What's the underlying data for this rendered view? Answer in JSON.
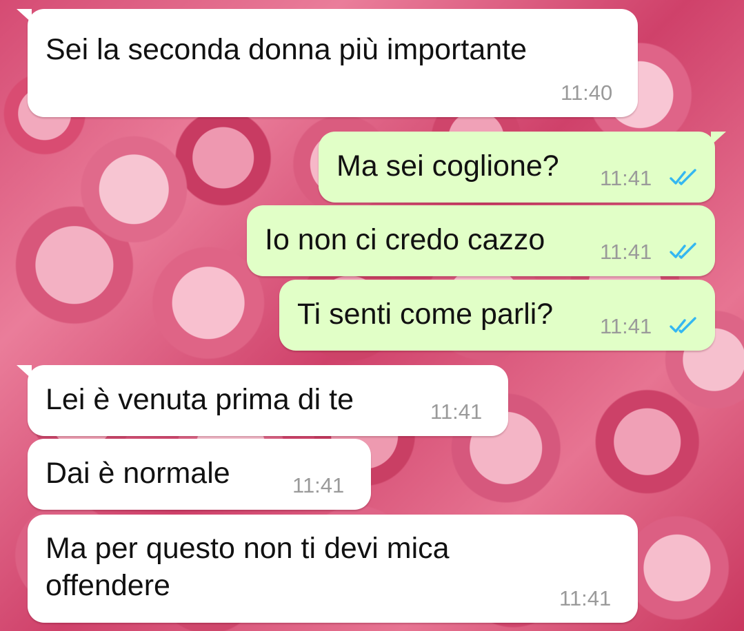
{
  "chat": {
    "messages": [
      {
        "direction": "incoming",
        "text": "Sei la seconda donna più importante",
        "time": "11:40"
      },
      {
        "direction": "outgoing",
        "text": "Ma sei coglione?",
        "time": "11:41",
        "status_icon": "double-check-icon"
      },
      {
        "direction": "outgoing",
        "text": "Io non ci credo cazzo",
        "time": "11:41",
        "status_icon": "double-check-icon"
      },
      {
        "direction": "outgoing",
        "text": "Ti senti come parli?",
        "time": "11:41",
        "status_icon": "double-check-icon"
      },
      {
        "direction": "incoming",
        "text": "Lei è venuta prima di te",
        "time": "11:41"
      },
      {
        "direction": "incoming",
        "text": "Dai è normale",
        "time": "11:41"
      },
      {
        "direction": "incoming",
        "text_lines": [
          "Ma per questo non ti devi mica",
          "offendere"
        ],
        "time": "11:41"
      }
    ]
  },
  "colors": {
    "incoming_bubble": "#ffffff",
    "outgoing_bubble": "#e1ffc7",
    "read_receipt": "#34b7f1",
    "timestamp": "#9a9a9a",
    "text": "#111111"
  }
}
